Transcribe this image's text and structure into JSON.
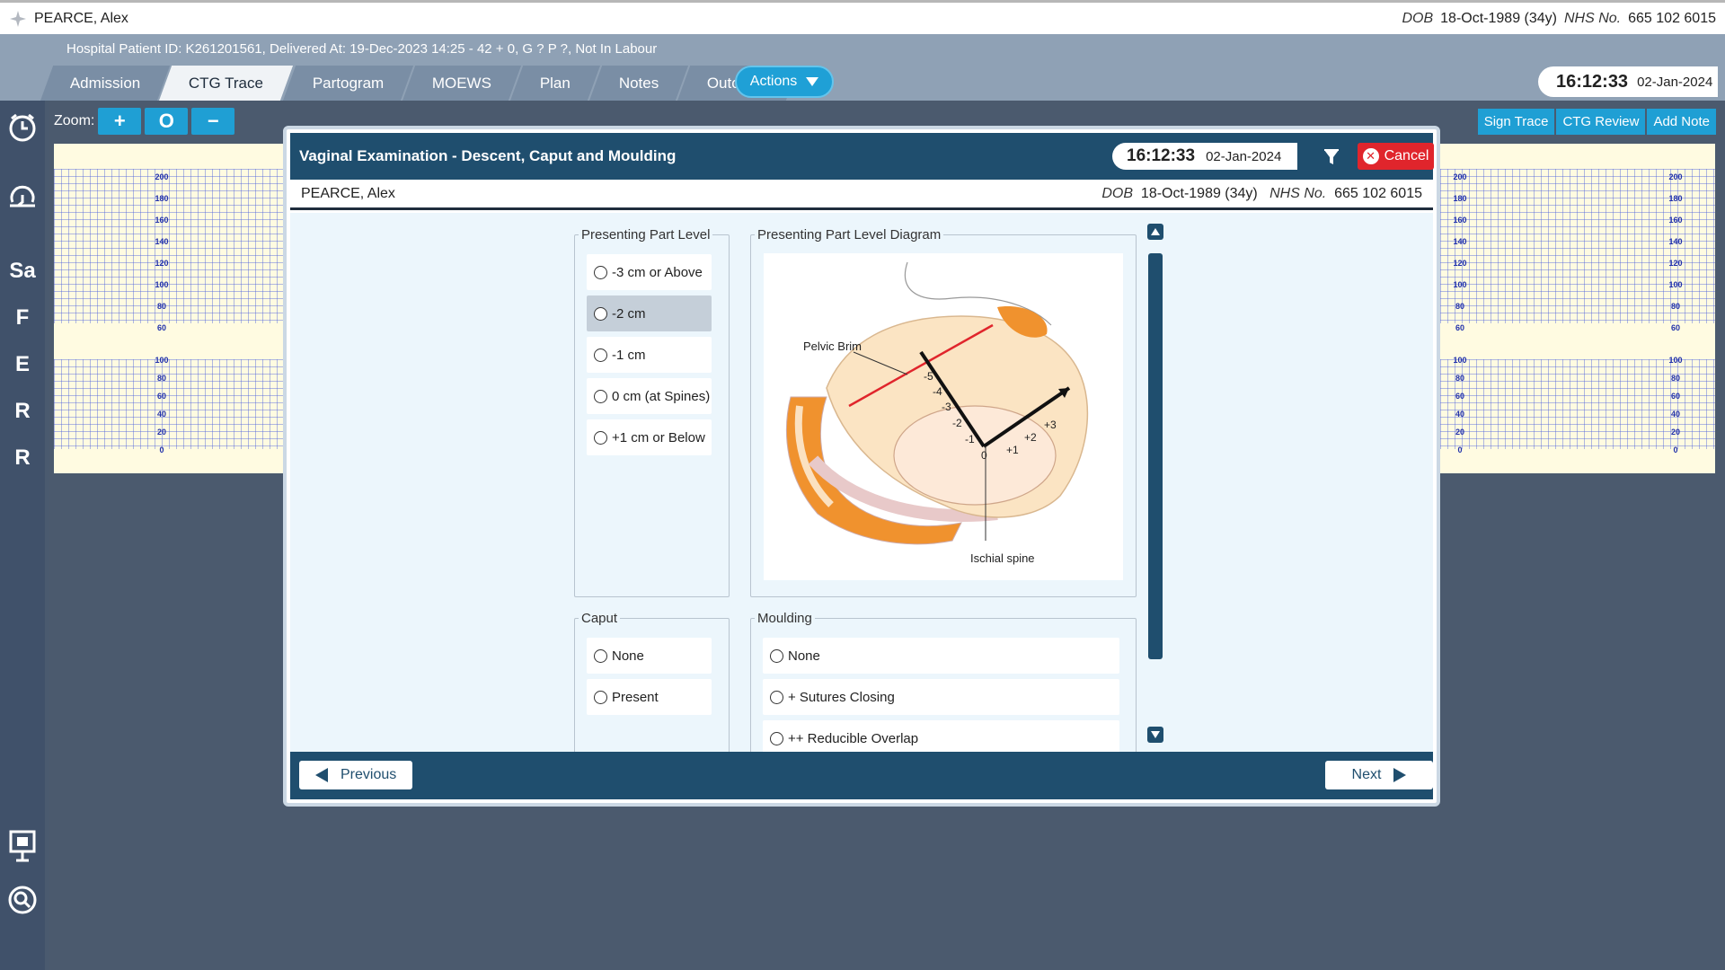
{
  "patient": {
    "name": "PEARCE, Alex",
    "dob_label": "DOB",
    "dob": "18-Oct-1989 (34y)",
    "nhs_label": "NHS No.",
    "nhs": "665 102 6015"
  },
  "header": {
    "info": "Hospital Patient ID: K261201561, Delivered At: 19-Dec-2023 14:25 - 42 + 0, G ? P ?,   Not In Labour",
    "tabs": [
      "Admission",
      "CTG Trace",
      "Partogram",
      "MOEWS",
      "Plan",
      "Notes",
      "Outcome"
    ],
    "active_tab": "CTG Trace",
    "actions_label": "Actions",
    "time": "16:12:33",
    "date": "02-Jan-2024"
  },
  "rail": {
    "letters": [
      "Sa",
      "F",
      "E",
      "R",
      "R"
    ]
  },
  "toolbar": {
    "zoom_label": "Zoom:",
    "zoom_in": "+",
    "zoom_reset": "O",
    "zoom_out": "−",
    "sign_trace": "Sign Trace",
    "ctg_review": "CTG Review",
    "add_note": "Add Note"
  },
  "ctg": {
    "fhr_ticks": [
      "200",
      "180",
      "160",
      "140",
      "120",
      "100",
      "80",
      "60"
    ],
    "toco_ticks": [
      "100",
      "80",
      "60",
      "40",
      "20",
      "0"
    ]
  },
  "modal": {
    "title": "Vaginal Examination - Descent, Caput and Moulding",
    "time": "16:12:33",
    "date": "02-Jan-2024",
    "cancel_label": "Cancel",
    "presenting_level": {
      "legend": "Presenting Part Level",
      "options": [
        "-3 cm or Above",
        "-2 cm",
        "-1 cm",
        "0 cm (at Spines)",
        "+1 cm or Below"
      ],
      "highlighted": "-2 cm"
    },
    "diagram": {
      "legend": "Presenting Part Level Diagram",
      "pelvic_brim": "Pelvic Brim",
      "ischial_spine": "Ischial spine",
      "ticks_neg": [
        "-5",
        "-4",
        "-3",
        "-2",
        "-1"
      ],
      "zero": "0",
      "ticks_pos": [
        "+1",
        "+2",
        "+3"
      ]
    },
    "caput": {
      "legend": "Caput",
      "options": [
        "None",
        "Present"
      ]
    },
    "moulding": {
      "legend": "Moulding",
      "options": [
        "None",
        "+ Sutures Closing",
        "++ Reducible Overlap"
      ]
    },
    "previous_label": "Previous",
    "next_label": "Next"
  },
  "colors": {
    "accent": "#1f9fd4",
    "modal_header": "#1f4e6e",
    "cancel": "#e0252c",
    "ctg_bg": "#fffbe1"
  }
}
